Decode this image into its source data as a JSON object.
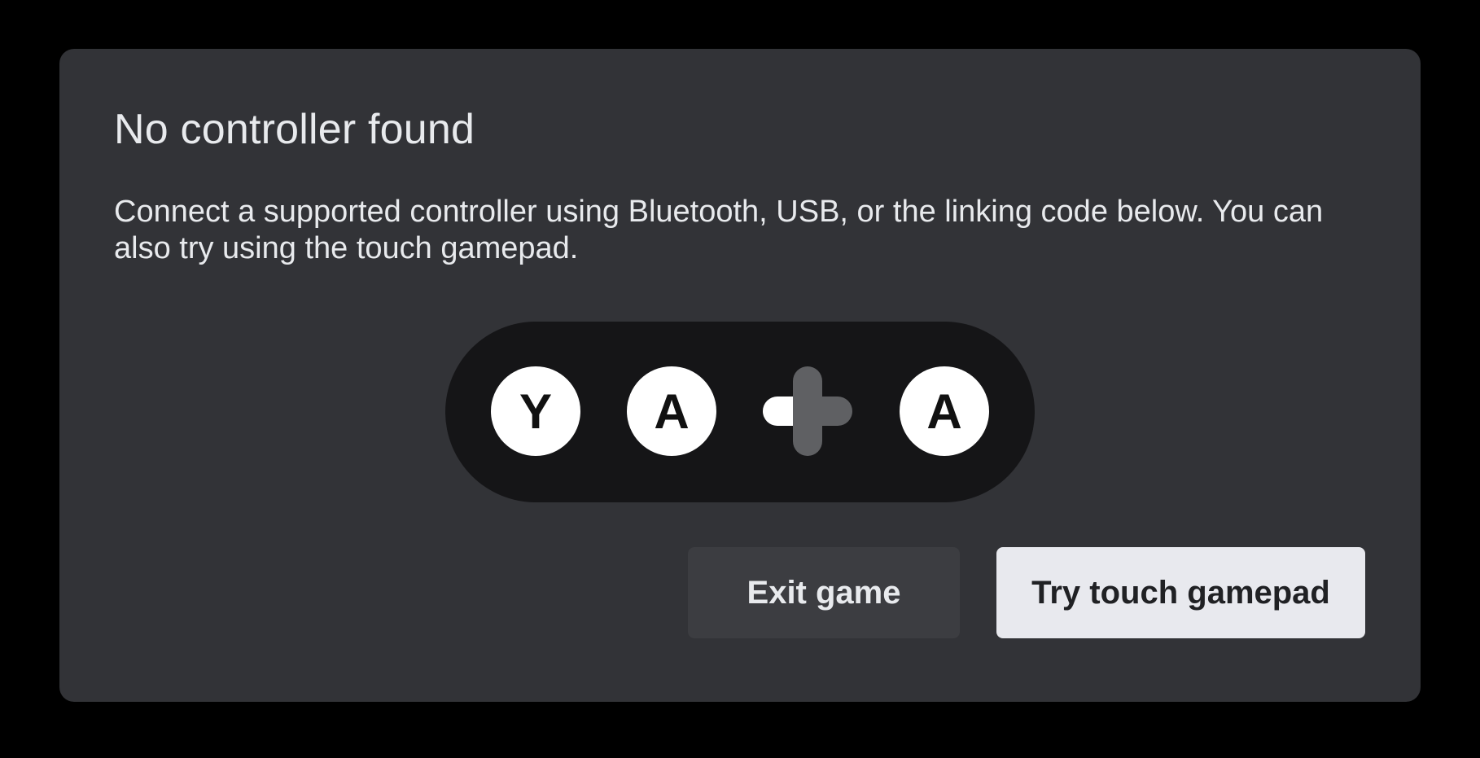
{
  "dialog": {
    "title": "No controller found",
    "description": "Connect a supported controller using Bluetooth, USB, or the linking code below. You can also try using the touch gamepad."
  },
  "controller_illustration": {
    "buttons": [
      "Y",
      "A",
      "A"
    ],
    "icons": [
      "y-button-icon",
      "a-button-icon",
      "dpad-icon",
      "a-button-icon"
    ]
  },
  "actions": {
    "exit_label": "Exit game",
    "touch_label": "Try touch gamepad"
  },
  "colors": {
    "background": "#000000",
    "dialog": "#323337",
    "text": "#e8eaed",
    "controller_body": "#151517",
    "secondary_button": "#3c3d41",
    "primary_button": "#e8e9ee"
  }
}
